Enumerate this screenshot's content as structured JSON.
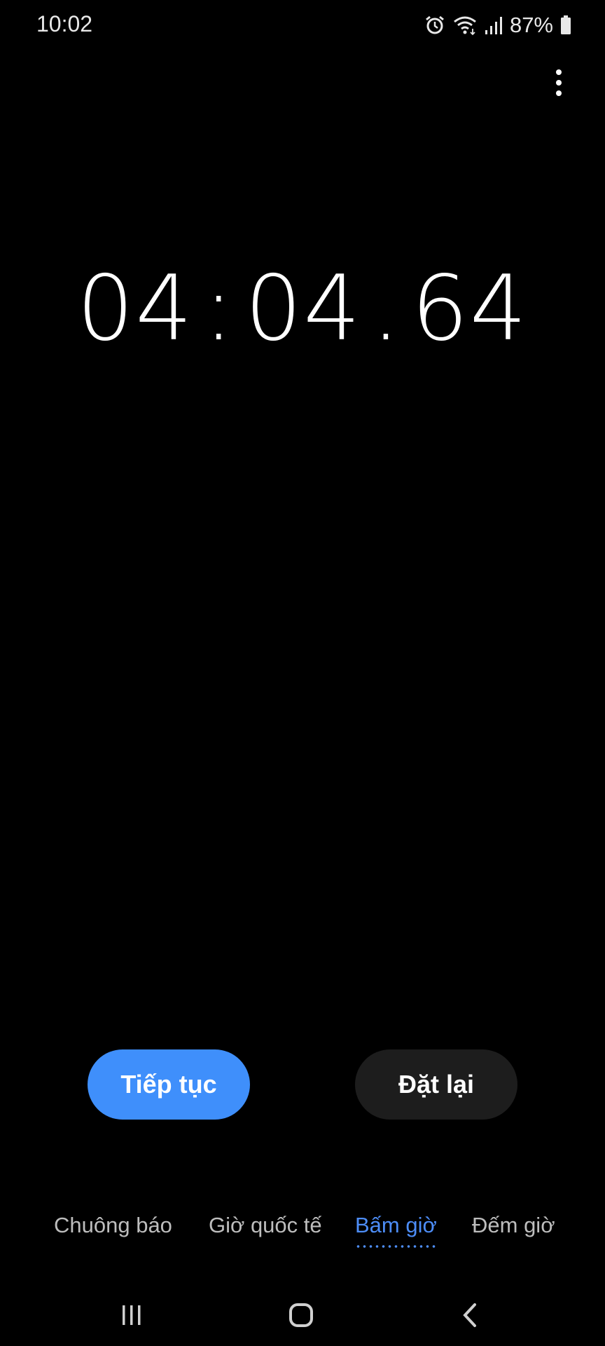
{
  "status_bar": {
    "time": "10:02",
    "battery_percent": "87%",
    "icons": [
      "alarm-icon",
      "wifi-icon",
      "signal-icon",
      "battery-icon"
    ]
  },
  "timer": {
    "minutes": "04",
    "separator1": ":",
    "seconds": "04",
    "separator2": ".",
    "hundredths": "64"
  },
  "buttons": {
    "resume_label": "Tiếp tục",
    "reset_label": "Đặt lại"
  },
  "tabs": [
    {
      "label": "Chuông báo",
      "active": false
    },
    {
      "label": "Giờ quốc tế",
      "active": false
    },
    {
      "label": "Bấm giờ",
      "active": true
    },
    {
      "label": "Đếm giờ",
      "active": false
    }
  ],
  "colors": {
    "background": "#000000",
    "accent": "#3f8ffb",
    "active_tab": "#4d8df7",
    "secondary_button": "#1d1d1d"
  },
  "navbar": {
    "icons": [
      "recent-apps-icon",
      "home-icon",
      "back-icon"
    ]
  }
}
